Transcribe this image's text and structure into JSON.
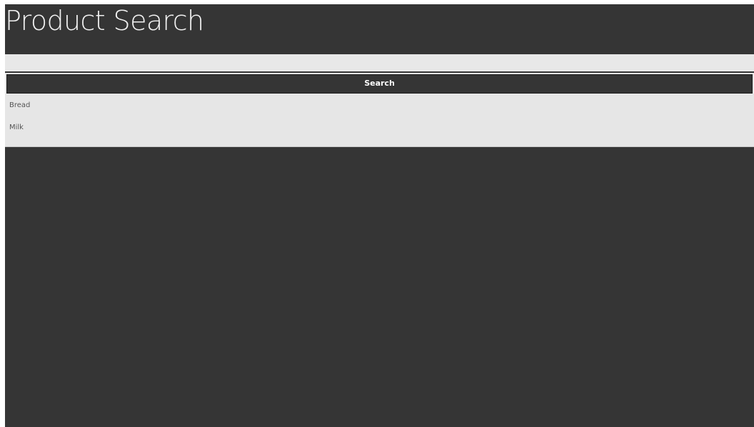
{
  "app": {
    "title": "Product Search",
    "background_color": "#353535"
  },
  "search": {
    "input_value": "",
    "button_label": "Search"
  },
  "results": {
    "items": [
      {
        "label": "Bread"
      },
      {
        "label": "Milk"
      }
    ]
  }
}
